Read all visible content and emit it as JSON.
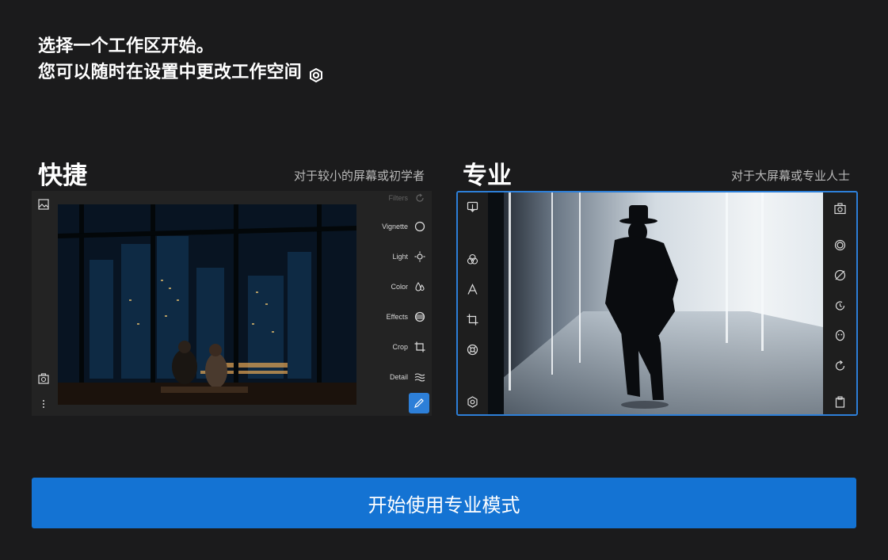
{
  "intro": {
    "line1": "选择一个工作区开始。",
    "line2": "您可以随时在设置中更改工作空间",
    "settings_icon": "gear-icon"
  },
  "quick": {
    "title": "快捷",
    "subtitle": "对于较小的屏幕或初学者",
    "controls": [
      {
        "label": "Filters",
        "icon": "rotate-icon"
      },
      {
        "label": "Vignette",
        "icon": "vignette-icon"
      },
      {
        "label": "Light",
        "icon": "sun-icon"
      },
      {
        "label": "Color",
        "icon": "drops-icon"
      },
      {
        "label": "Effects",
        "icon": "effects-icon"
      },
      {
        "label": "Crop",
        "icon": "crop-icon"
      },
      {
        "label": "Detail",
        "icon": "waves-icon"
      }
    ]
  },
  "pro": {
    "title": "专业",
    "subtitle": "对于大屏幕或专业人士"
  },
  "start_button": "开始使用专业模式",
  "colors": {
    "background": "#1b1b1c",
    "accent": "#1473d3",
    "selected_border": "#2d7fd8"
  }
}
